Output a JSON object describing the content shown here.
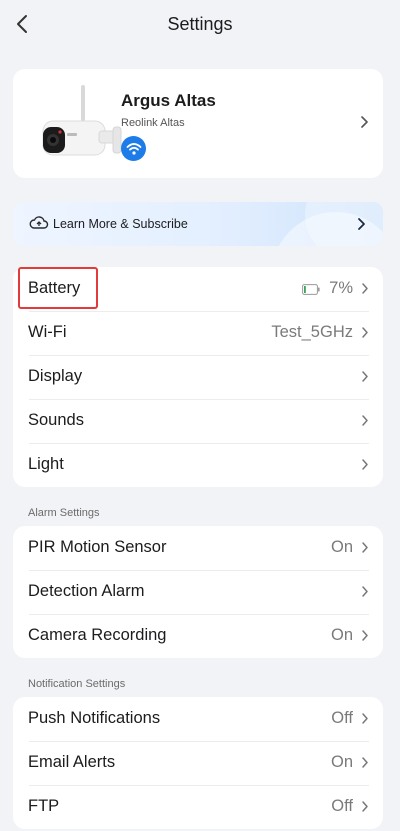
{
  "header": {
    "title": "Settings"
  },
  "device": {
    "name": "Argus Altas",
    "model": "Reolink Altas"
  },
  "promo": {
    "label": "Learn More & Subscribe"
  },
  "general": {
    "items": [
      {
        "label": "Battery",
        "value": "7%"
      },
      {
        "label": "Wi-Fi",
        "value": "Test_5GHz"
      },
      {
        "label": "Display",
        "value": ""
      },
      {
        "label": "Sounds",
        "value": ""
      },
      {
        "label": "Light",
        "value": ""
      }
    ],
    "battery_level_percent": 7
  },
  "alarm": {
    "title": "Alarm Settings",
    "items": [
      {
        "label": "PIR Motion Sensor",
        "value": "On"
      },
      {
        "label": "Detection Alarm",
        "value": ""
      },
      {
        "label": "Camera Recording",
        "value": "On"
      }
    ]
  },
  "notification": {
    "title": "Notification Settings",
    "items": [
      {
        "label": "Push Notifications",
        "value": "Off"
      },
      {
        "label": "Email Alerts",
        "value": "On"
      },
      {
        "label": "FTP",
        "value": "Off"
      }
    ]
  },
  "colors": {
    "accent": "#1e7ce8",
    "highlight": "#e23b3b",
    "background": "#f2f3f6"
  }
}
